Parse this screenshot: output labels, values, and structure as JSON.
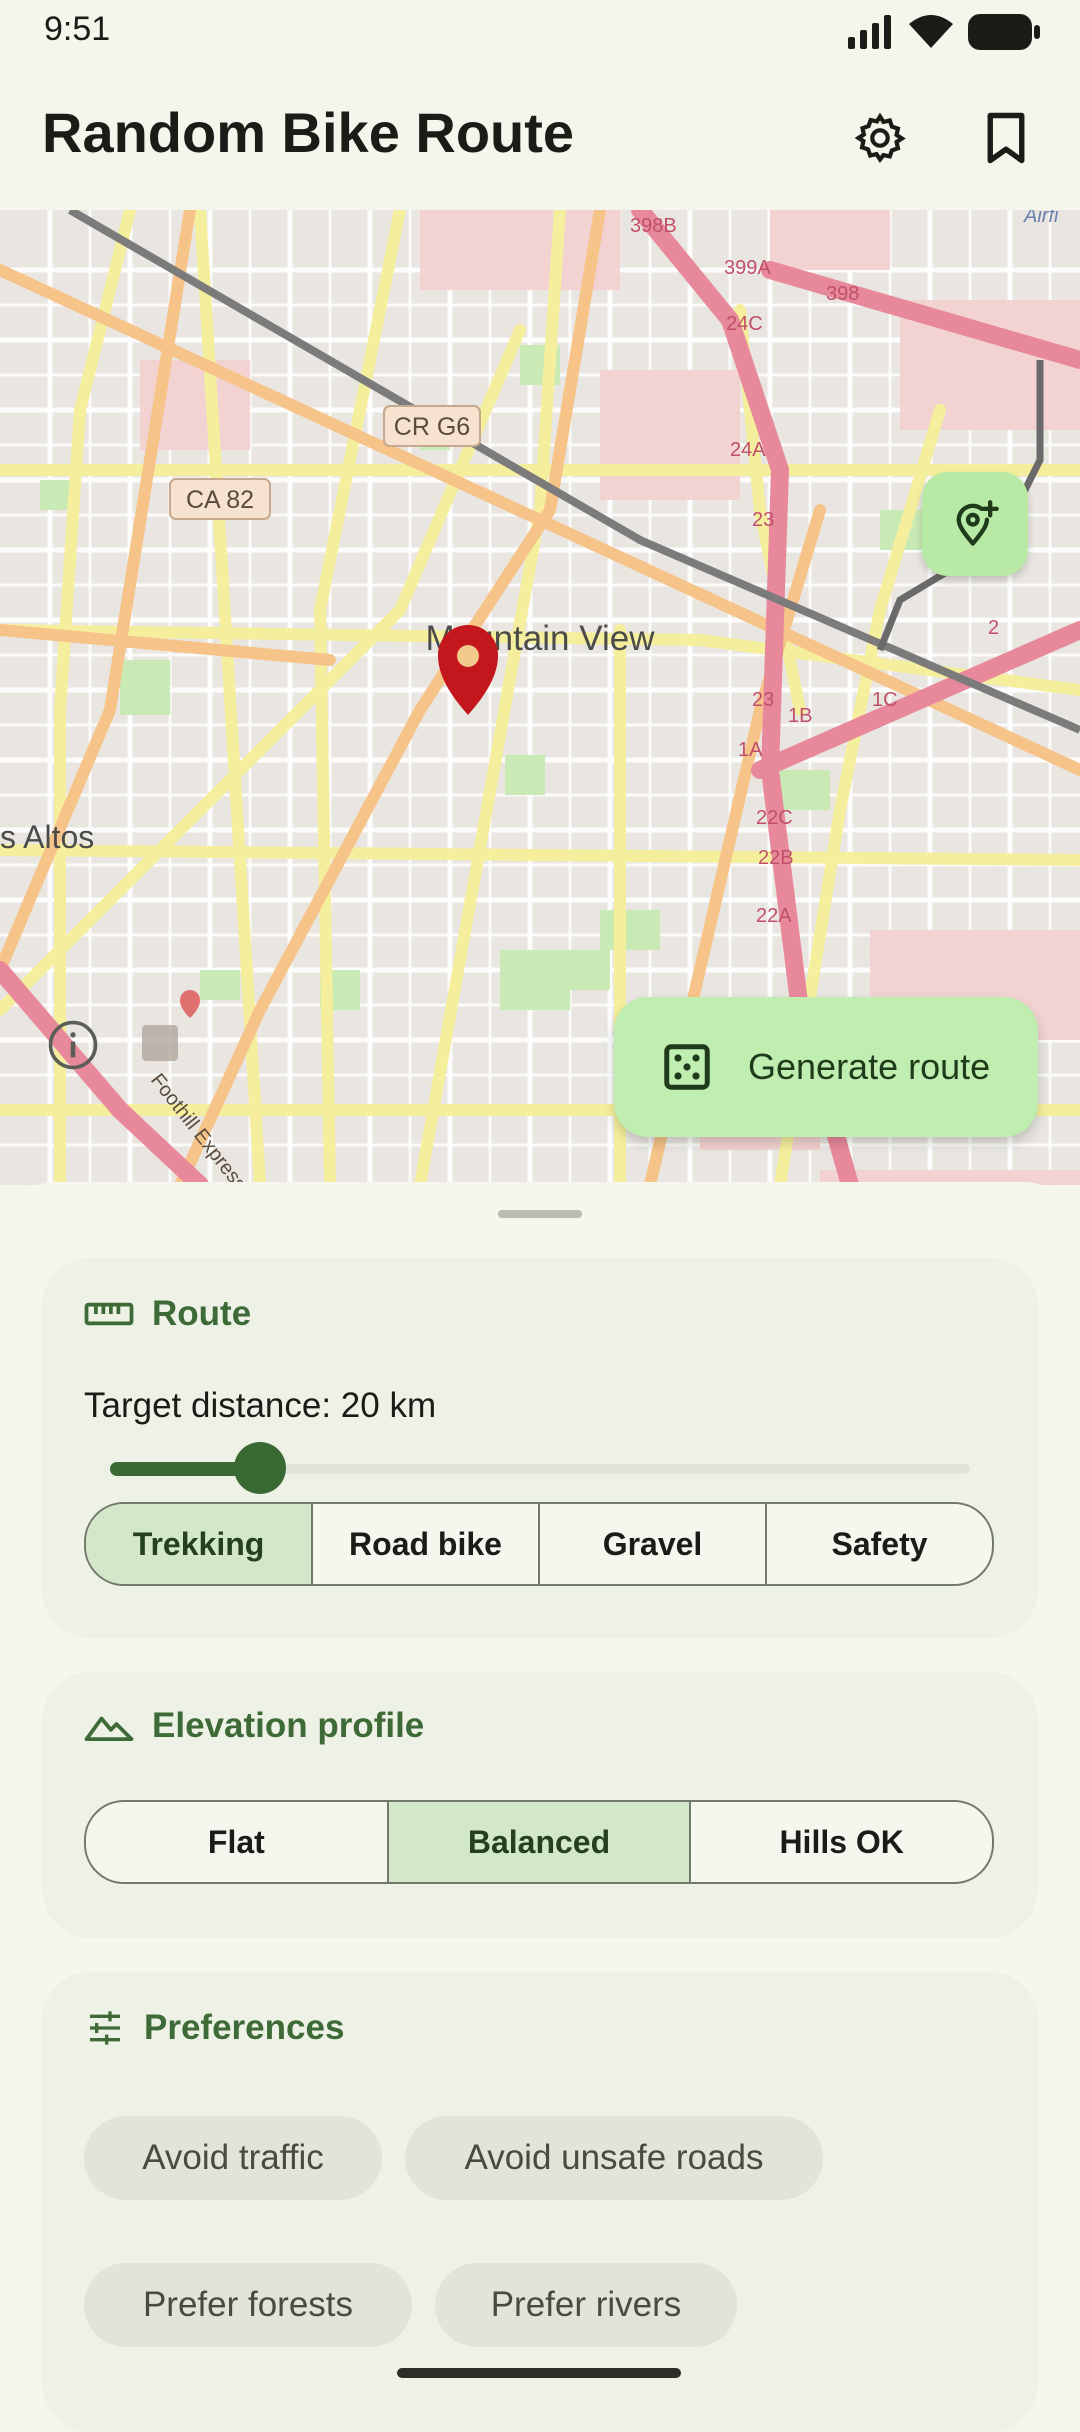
{
  "status": {
    "time": "9:51"
  },
  "appbar": {
    "title": "Random Bike Route"
  },
  "map": {
    "labels": {
      "cr_g6": "CR G6",
      "ca_82": "CA 82",
      "mountain_view": "Mountain View",
      "los_altos": "s Altos",
      "expressway": "Foothill Expressway",
      "r398b": "398B",
      "r399a": "399A",
      "r398": "398",
      "r24c": "24C",
      "r24a": "24A",
      "r23a": "23",
      "r23b": "23",
      "r1b": "1B",
      "r1c": "1C",
      "r1a": "1A",
      "r2": "2",
      "r22c": "22C",
      "r22b": "22B",
      "r22a": "22A",
      "airfield": "Airfi"
    },
    "generate_label": "Generate route"
  },
  "route": {
    "title": "Route",
    "distance_label": "Target distance: 20 km",
    "slider_fraction": 0.16,
    "bike_types": [
      "Trekking",
      "Road bike",
      "Gravel",
      "Safety"
    ],
    "selected_bike": "Trekking"
  },
  "elevation": {
    "title": "Elevation profile",
    "options": [
      "Flat",
      "Balanced",
      "Hills OK"
    ],
    "selected": "Balanced"
  },
  "preferences": {
    "title": "Preferences",
    "chips": [
      "Avoid traffic",
      "Avoid unsafe roads",
      "Prefer forests",
      "Prefer rivers"
    ]
  },
  "colors": {
    "accent": "#3a6a33",
    "fab": "#bfeeb0",
    "pin": "#c4171d"
  }
}
